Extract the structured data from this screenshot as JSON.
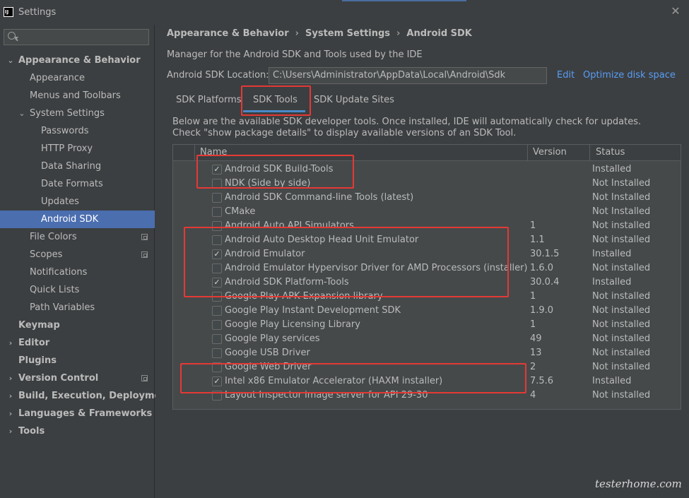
{
  "window": {
    "title": "Settings",
    "app_icon_text": "IJ",
    "close_glyph": "✕"
  },
  "sidebar": {
    "search_placeholder": "",
    "items": [
      {
        "label": "Appearance & Behavior",
        "level": 0,
        "bold": true,
        "arrow": "⌄",
        "selected": false,
        "project_icon": false
      },
      {
        "label": "Appearance",
        "level": 1,
        "bold": false,
        "arrow": "",
        "selected": false,
        "project_icon": false
      },
      {
        "label": "Menus and Toolbars",
        "level": 1,
        "bold": false,
        "arrow": "",
        "selected": false,
        "project_icon": false
      },
      {
        "label": "System Settings",
        "level": 1,
        "bold": false,
        "arrow": "⌄",
        "selected": false,
        "project_icon": false
      },
      {
        "label": "Passwords",
        "level": 2,
        "bold": false,
        "arrow": "",
        "selected": false,
        "project_icon": false
      },
      {
        "label": "HTTP Proxy",
        "level": 2,
        "bold": false,
        "arrow": "",
        "selected": false,
        "project_icon": false
      },
      {
        "label": "Data Sharing",
        "level": 2,
        "bold": false,
        "arrow": "",
        "selected": false,
        "project_icon": false
      },
      {
        "label": "Date Formats",
        "level": 2,
        "bold": false,
        "arrow": "",
        "selected": false,
        "project_icon": false
      },
      {
        "label": "Updates",
        "level": 2,
        "bold": false,
        "arrow": "",
        "selected": false,
        "project_icon": false
      },
      {
        "label": "Android SDK",
        "level": 2,
        "bold": false,
        "arrow": "",
        "selected": true,
        "project_icon": false
      },
      {
        "label": "File Colors",
        "level": 1,
        "bold": false,
        "arrow": "",
        "selected": false,
        "project_icon": true
      },
      {
        "label": "Scopes",
        "level": 1,
        "bold": false,
        "arrow": "",
        "selected": false,
        "project_icon": true
      },
      {
        "label": "Notifications",
        "level": 1,
        "bold": false,
        "arrow": "",
        "selected": false,
        "project_icon": false
      },
      {
        "label": "Quick Lists",
        "level": 1,
        "bold": false,
        "arrow": "",
        "selected": false,
        "project_icon": false
      },
      {
        "label": "Path Variables",
        "level": 1,
        "bold": false,
        "arrow": "",
        "selected": false,
        "project_icon": false
      },
      {
        "label": "Keymap",
        "level": 0,
        "bold": true,
        "arrow": "",
        "selected": false,
        "project_icon": false
      },
      {
        "label": "Editor",
        "level": 0,
        "bold": true,
        "arrow": "›",
        "selected": false,
        "project_icon": false
      },
      {
        "label": "Plugins",
        "level": 0,
        "bold": true,
        "arrow": "",
        "selected": false,
        "project_icon": false
      },
      {
        "label": "Version Control",
        "level": 0,
        "bold": true,
        "arrow": "›",
        "selected": false,
        "project_icon": true
      },
      {
        "label": "Build, Execution, Deployment",
        "level": 0,
        "bold": true,
        "arrow": "›",
        "selected": false,
        "project_icon": false
      },
      {
        "label": "Languages & Frameworks",
        "level": 0,
        "bold": true,
        "arrow": "›",
        "selected": false,
        "project_icon": false
      },
      {
        "label": "Tools",
        "level": 0,
        "bold": true,
        "arrow": "›",
        "selected": false,
        "project_icon": false
      }
    ]
  },
  "content": {
    "breadcrumb": [
      "Appearance & Behavior",
      "System Settings",
      "Android SDK"
    ],
    "breadcrumb_sep": "›",
    "description": "Manager for the Android SDK and Tools used by the IDE",
    "sdk_location_label": "Android SDK Location:",
    "sdk_location_value": "C:\\Users\\Administrator\\AppData\\Local\\Android\\Sdk",
    "edit_link": "Edit",
    "optimize_link": "Optimize disk space",
    "tabs": [
      "SDK Platforms",
      "SDK Tools",
      "SDK Update Sites"
    ],
    "active_tab": "SDK Tools",
    "info_line1": "Below are the available SDK developer tools. Once installed, IDE will automatically check for updates.",
    "info_line2": "Check \"show package details\" to display available versions of an SDK Tool.",
    "table": {
      "headers": {
        "name": "Name",
        "version": "Version",
        "status": "Status"
      },
      "rows": [
        {
          "checked": true,
          "name": "Android SDK Build-Tools",
          "version": "",
          "status": "Installed"
        },
        {
          "checked": false,
          "name": "NDK (Side by side)",
          "version": "",
          "status": "Not Installed"
        },
        {
          "checked": false,
          "name": "Android SDK Command-line Tools (latest)",
          "version": "",
          "status": "Not Installed"
        },
        {
          "checked": false,
          "name": "CMake",
          "version": "",
          "status": "Not Installed"
        },
        {
          "checked": false,
          "name": "Android Auto API Simulators",
          "version": "1",
          "status": "Not installed"
        },
        {
          "checked": false,
          "name": "Android Auto Desktop Head Unit Emulator",
          "version": "1.1",
          "status": "Not installed"
        },
        {
          "checked": true,
          "name": "Android Emulator",
          "version": "30.1.5",
          "status": "Installed"
        },
        {
          "checked": false,
          "name": "Android Emulator Hypervisor Driver for AMD Processors (installer)",
          "version": "1.6.0",
          "status": "Not installed"
        },
        {
          "checked": true,
          "name": "Android SDK Platform-Tools",
          "version": "30.0.4",
          "status": "Installed"
        },
        {
          "checked": false,
          "name": "Google Play APK Expansion library",
          "version": "1",
          "status": "Not installed"
        },
        {
          "checked": false,
          "name": "Google Play Instant Development SDK",
          "version": "1.9.0",
          "status": "Not installed"
        },
        {
          "checked": false,
          "name": "Google Play Licensing Library",
          "version": "1",
          "status": "Not installed"
        },
        {
          "checked": false,
          "name": "Google Play services",
          "version": "49",
          "status": "Not installed"
        },
        {
          "checked": false,
          "name": "Google USB Driver",
          "version": "13",
          "status": "Not installed"
        },
        {
          "checked": false,
          "name": "Google Web Driver",
          "version": "2",
          "status": "Not installed"
        },
        {
          "checked": true,
          "name": "Intel x86 Emulator Accelerator (HAXM installer)",
          "version": "7.5.6",
          "status": "Installed"
        },
        {
          "checked": false,
          "name": "Layout Inspector image server for API 29-30",
          "version": "4",
          "status": "Not installed"
        }
      ]
    }
  },
  "watermark": "testerhome.com",
  "colors": {
    "selection": "#4b6eaf",
    "link": "#589df6",
    "highlight_box": "#e53935",
    "tab_underline": "#4a88c7"
  }
}
